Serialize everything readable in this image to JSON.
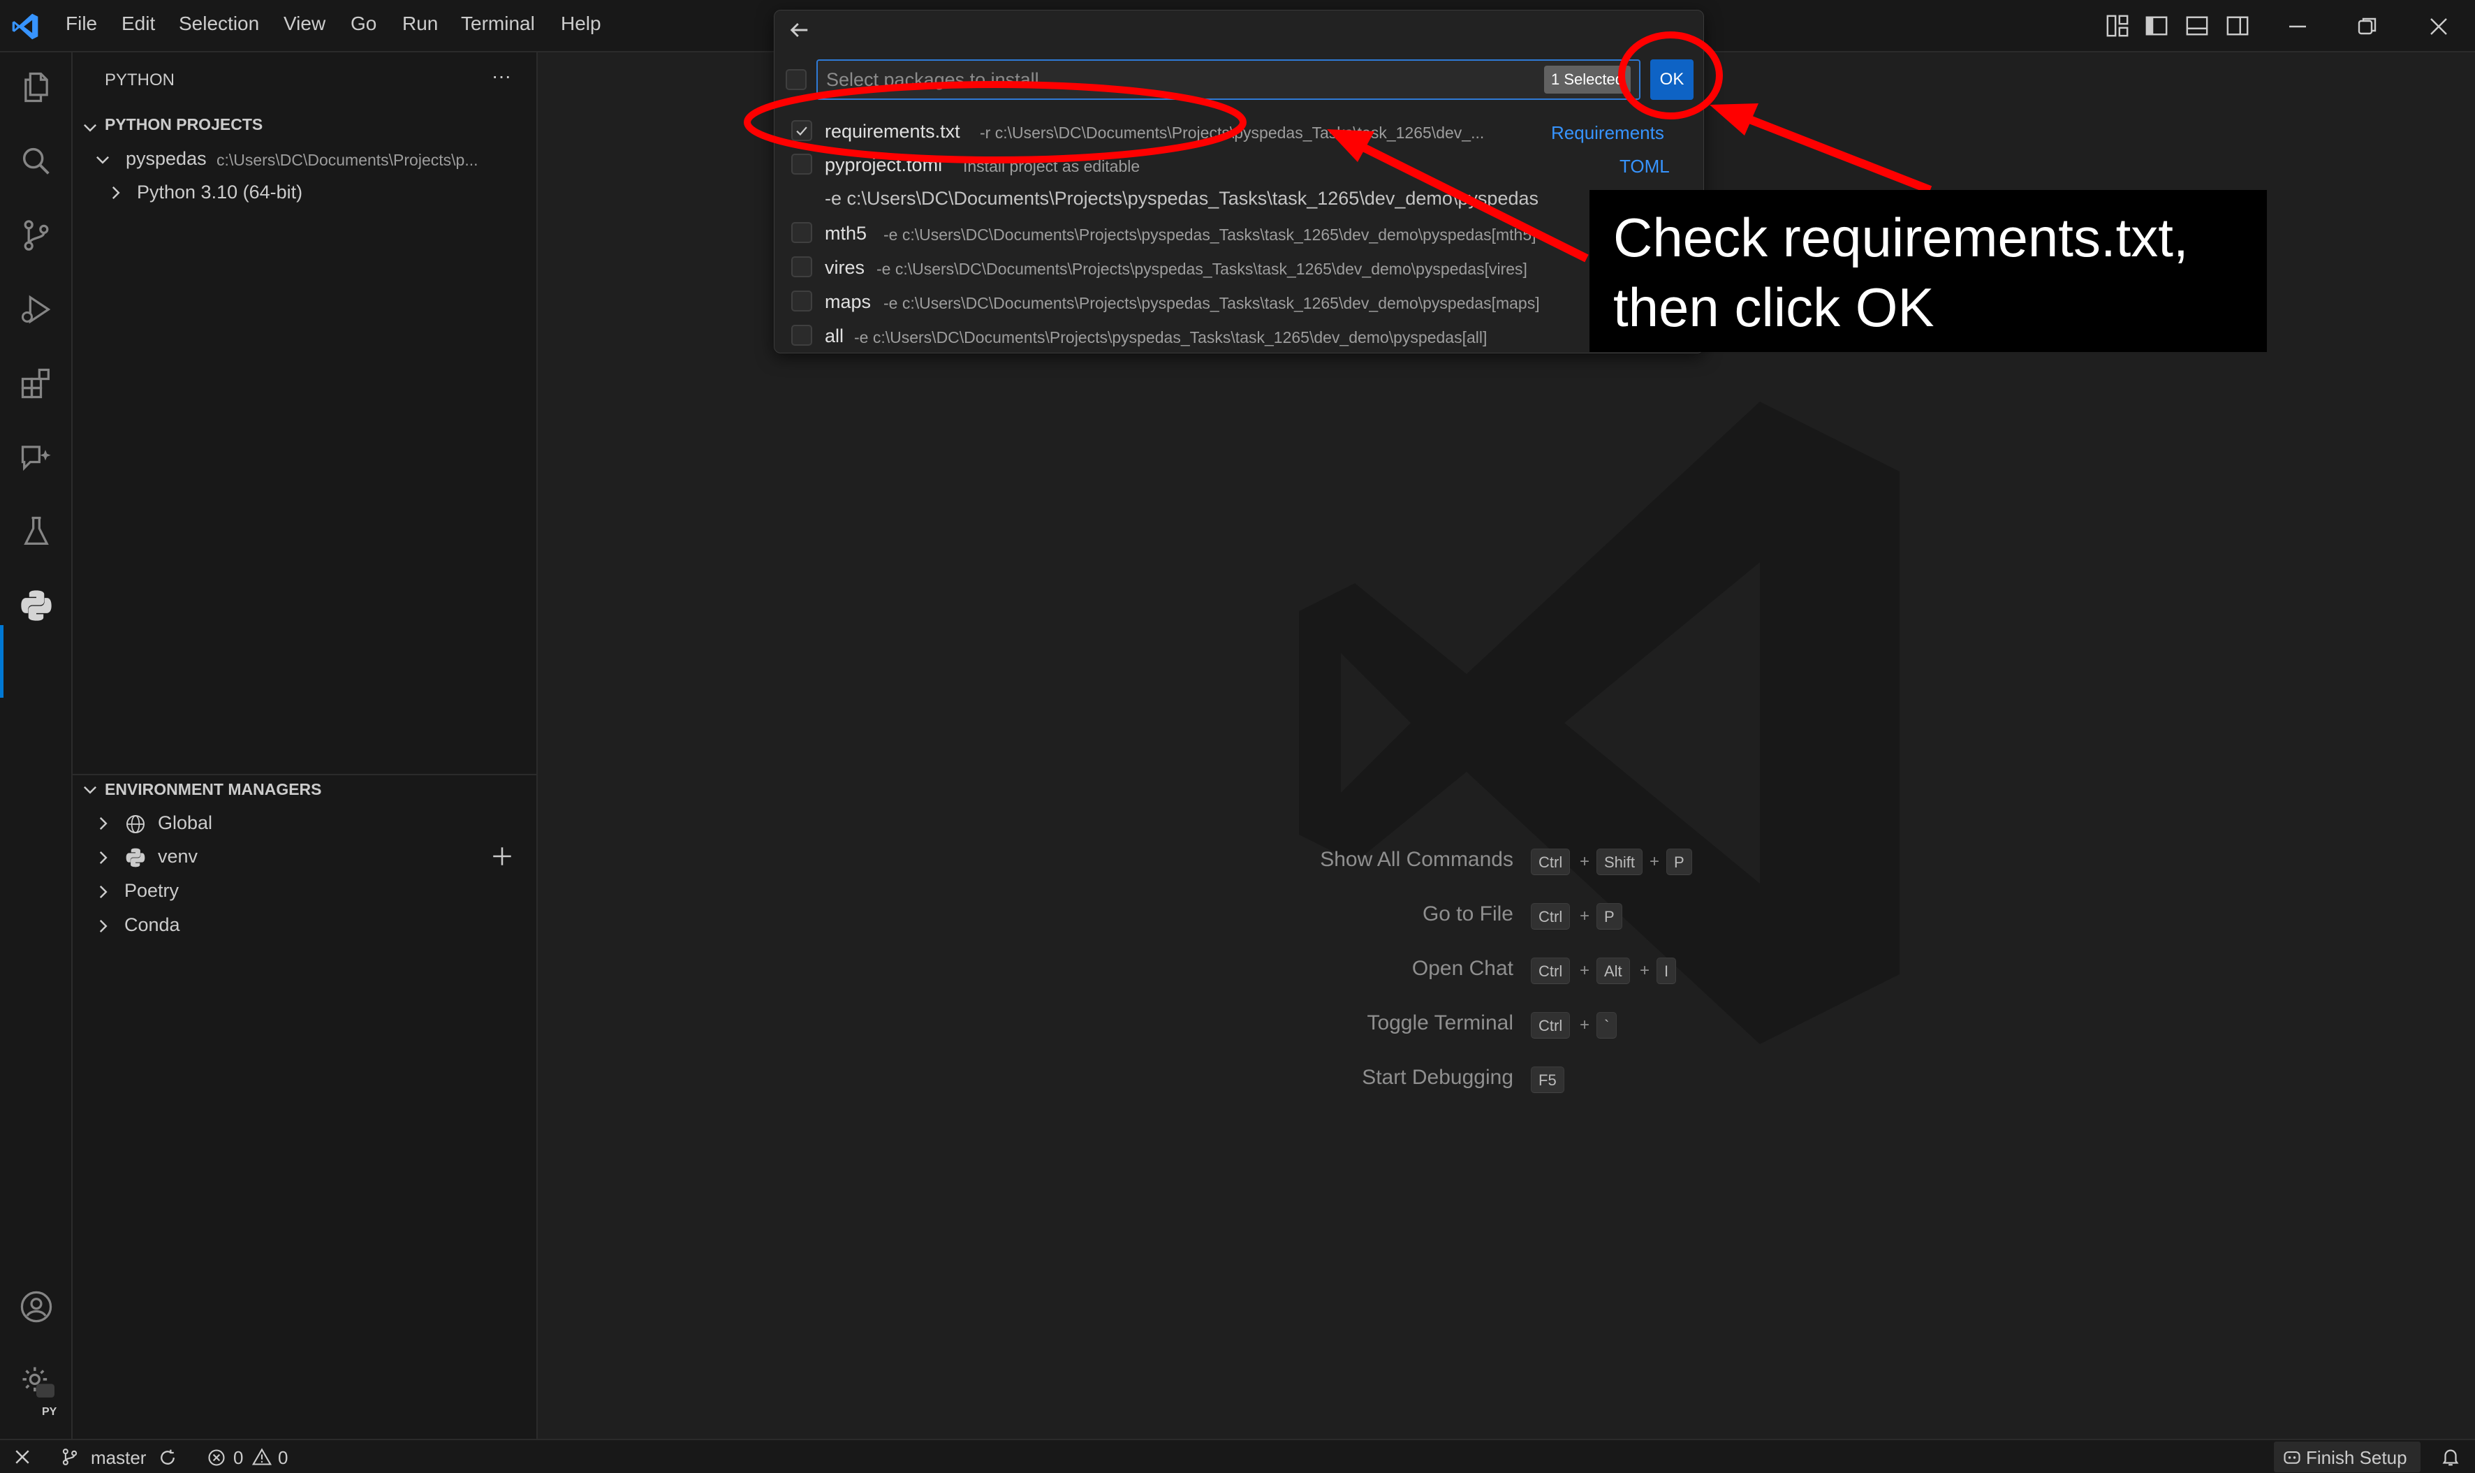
{
  "menu": {
    "items": [
      "File",
      "Edit",
      "Selection",
      "View",
      "Go",
      "Run",
      "Terminal",
      "Help"
    ]
  },
  "icons": {
    "activity": [
      "files-icon",
      "search-icon",
      "source-control-icon",
      "run-debug-icon",
      "extensions-icon",
      "chat-icon",
      "testing-icon",
      "python-icon"
    ],
    "bottom": [
      "account-icon",
      "settings-icon"
    ]
  },
  "colors": {
    "accent": "#0078d4",
    "ok_button": "#0e63c5",
    "annotation_red": "#ff0000",
    "link": "#3794ff"
  },
  "sidebar": {
    "title": "PYTHON",
    "more_label": "···",
    "projects_header": "PYTHON PROJECTS",
    "project_name": "pyspedas",
    "project_path": "c:\\Users\\DC\\Documents\\Projects\\p...",
    "interpreter": "Python 3.10 (64-bit)",
    "env_header": "ENVIRONMENT MANAGERS",
    "env_items": [
      "Global",
      "venv",
      "Poetry",
      "Conda"
    ]
  },
  "quickpick": {
    "placeholder": "Select packages to install",
    "selected_badge": "1 Selected",
    "ok_label": "OK",
    "items": [
      {
        "name": "requirements.txt",
        "detail": "-r c:\\Users\\DC\\Documents\\Projects\\pyspedas_Tasks\\task_1265\\dev_...",
        "tag": "Requirements",
        "checked": true
      },
      {
        "name": "pyproject.toml",
        "detail": "Install project as editable",
        "tag": "TOML",
        "checked": false
      },
      {
        "name": "",
        "detail": "-e c:\\Users\\DC\\Documents\\Projects\\pyspedas_Tasks\\task_1265\\dev_demo\\pyspedas",
        "tag": "",
        "checked": false
      },
      {
        "name": "mth5",
        "detail": "-e c:\\Users\\DC\\Documents\\Projects\\pyspedas_Tasks\\task_1265\\dev_demo\\pyspedas[mth5]",
        "tag": "",
        "checked": false
      },
      {
        "name": "vires",
        "detail": "-e c:\\Users\\DC\\Documents\\Projects\\pyspedas_Tasks\\task_1265\\dev_demo\\pyspedas[vires]",
        "tag": "",
        "checked": false
      },
      {
        "name": "maps",
        "detail": "-e c:\\Users\\DC\\Documents\\Projects\\pyspedas_Tasks\\task_1265\\dev_demo\\pyspedas[maps]",
        "tag": "",
        "checked": false
      },
      {
        "name": "all",
        "detail": "-e c:\\Users\\DC\\Documents\\Projects\\pyspedas_Tasks\\task_1265\\dev_demo\\pyspedas[all]",
        "tag": "",
        "checked": false
      }
    ]
  },
  "annotation": {
    "line1": "Check requirements.txt,",
    "line2": "then click OK"
  },
  "shortcuts": [
    {
      "label": "Show All Commands",
      "keys": [
        "Ctrl",
        "Shift",
        "P"
      ]
    },
    {
      "label": "Go to File",
      "keys": [
        "Ctrl",
        "P"
      ]
    },
    {
      "label": "Open Chat",
      "keys": [
        "Ctrl",
        "Alt",
        "I"
      ]
    },
    {
      "label": "Toggle Terminal",
      "keys": [
        "Ctrl",
        "`"
      ]
    },
    {
      "label": "Start Debugging",
      "keys": [
        "F5"
      ]
    }
  ],
  "plus_sign": "+",
  "status": {
    "branch": "master",
    "errors": "0",
    "warnings": "0",
    "finish_setup": "Finish Setup",
    "settings_badge": "PY"
  }
}
